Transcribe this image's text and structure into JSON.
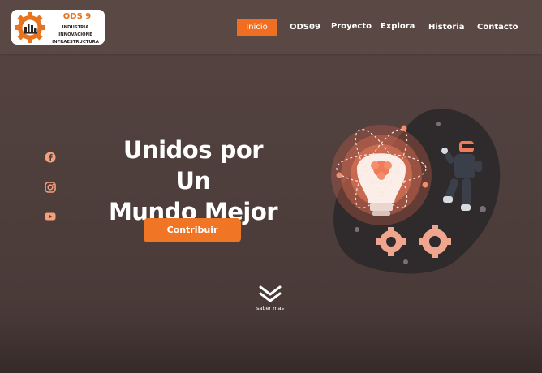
{
  "colors": {
    "accent": "#f06e22",
    "background": "#4f3f3d",
    "navbar": "#5a4845",
    "text": "#ffffff"
  },
  "logo": {
    "title": "ODS 9",
    "subtitle_line1": "INDUSTRIA INNOVACIÓNE",
    "subtitle_line2": "INFRAESTRUCTURA",
    "icon": "gear-factory-icon"
  },
  "nav": {
    "items": [
      {
        "label": "Inicio",
        "active": true
      },
      {
        "label": "ODS09"
      },
      {
        "label": "Proyecto"
      },
      {
        "label": "Explora"
      },
      {
        "label": "Historia"
      },
      {
        "label": "Contacto"
      }
    ]
  },
  "social": [
    {
      "name": "facebook-icon"
    },
    {
      "name": "instagram-icon"
    },
    {
      "name": "youtube-icon"
    }
  ],
  "hero": {
    "title_line1": "Unidos por Un",
    "title_line2": "Mundo Mejor",
    "cta_label": "Contribuir",
    "illustration": "lightbulb-atom-robot-illustration"
  },
  "scroll": {
    "label": "saber mas",
    "icon": "double-chevron-down-icon"
  }
}
